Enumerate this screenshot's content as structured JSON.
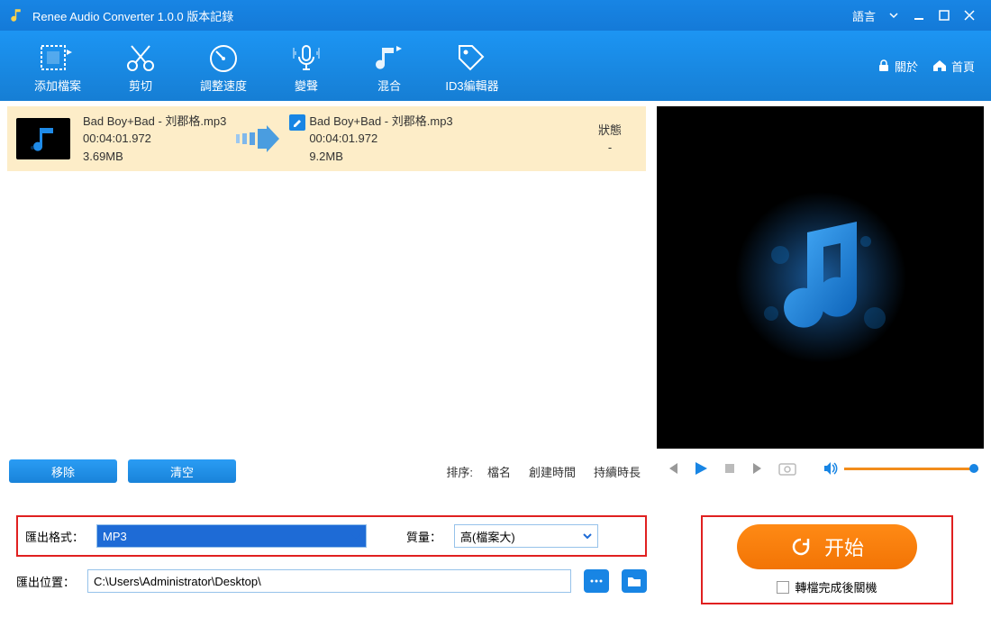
{
  "title": "Renee Audio Converter 1.0.0 版本記錄",
  "header": {
    "language": "語言"
  },
  "toolbar": {
    "add": "添加檔案",
    "cut": "剪切",
    "speed": "調整速度",
    "voice": "變聲",
    "mix": "混合",
    "id3": "ID3編輯器",
    "about": "關於",
    "home": "首頁"
  },
  "file": {
    "src_name": "Bad Boy+Bad - 刘郡格.mp3",
    "src_dur": "00:04:01.972",
    "src_size": "3.69MB",
    "out_name": "Bad Boy+Bad - 刘郡格.mp3",
    "out_dur": "00:04:01.972",
    "out_size": "9.2MB",
    "status_hdr": "狀態",
    "status_val": "-"
  },
  "actions": {
    "remove": "移除",
    "clear": "清空"
  },
  "sort": {
    "label": "排序:",
    "name": "檔名",
    "created": "創建時間",
    "duration": "持續時長"
  },
  "export": {
    "format_label": "匯出格式：",
    "format_value": "MP3",
    "quality_label": "質量：",
    "quality_value": "高(檔案大)",
    "path_label": "匯出位置：",
    "path_value": "C:\\Users\\Administrator\\Desktop\\"
  },
  "start": {
    "label": "开始",
    "shutdown": "轉檔完成後關機"
  }
}
